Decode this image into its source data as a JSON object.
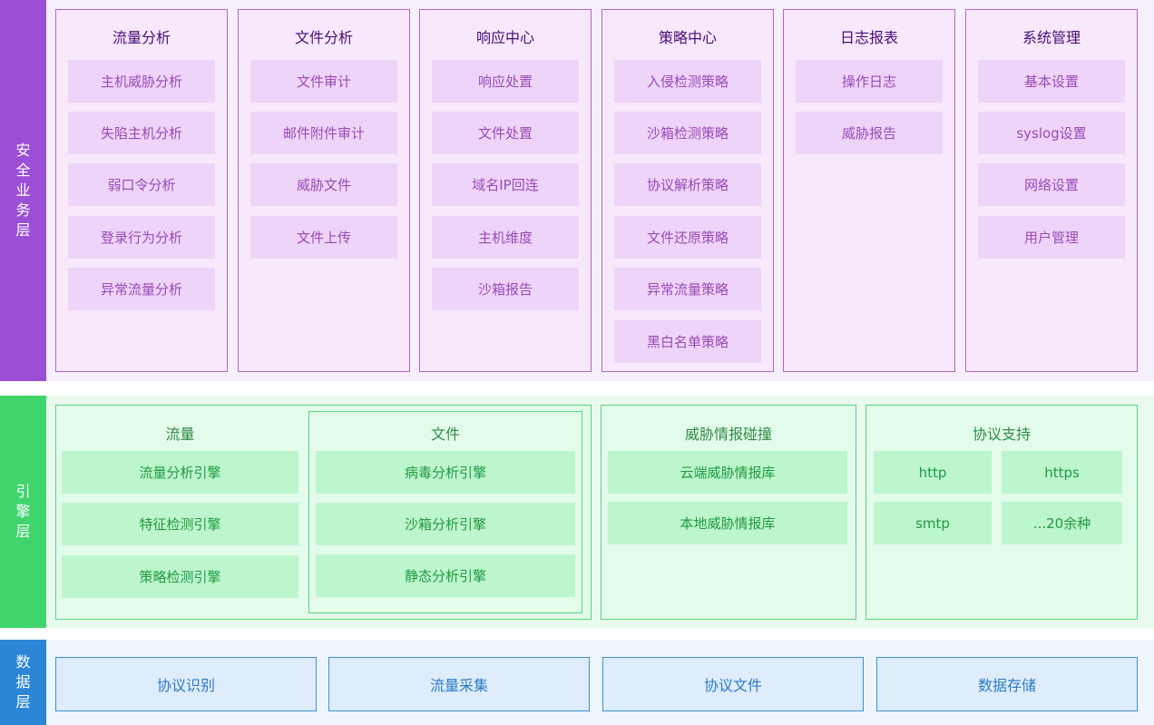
{
  "layers": {
    "security": {
      "label": "安全业务层",
      "columns": [
        {
          "title": "流量分析",
          "items": [
            "主机威胁分析",
            "失陷主机分析",
            "弱口令分析",
            "登录行为分析",
            "异常流量分析"
          ]
        },
        {
          "title": "文件分析",
          "items": [
            "文件审计",
            "邮件附件审计",
            "威胁文件",
            "文件上传"
          ]
        },
        {
          "title": "响应中心",
          "items": [
            "响应处置",
            "文件处置",
            "域名IP回连",
            "主机维度",
            "沙箱报告"
          ]
        },
        {
          "title": "策略中心",
          "items": [
            "入侵检测策略",
            "沙箱检测策略",
            "协议解析策略",
            "文件还原策略",
            "异常流量策略",
            "黑白名单策略"
          ]
        },
        {
          "title": "日志报表",
          "items": [
            "操作日志",
            "威胁报告"
          ]
        },
        {
          "title": "系统管理",
          "items": [
            "基本设置",
            "syslog设置",
            "网络设置",
            "用户管理"
          ]
        }
      ]
    },
    "engine": {
      "label": "引擎层",
      "traffic": {
        "title": "流量",
        "items": [
          "流量分析引擎",
          "特征检测引擎",
          "策略检测引擎"
        ]
      },
      "file": {
        "title": "文件",
        "items": [
          "病毒分析引擎",
          "沙箱分析引擎",
          "静态分析引擎"
        ]
      },
      "intel": {
        "title": "威胁情报碰撞",
        "items": [
          "云端威胁情报库",
          "本地威胁情报库"
        ]
      },
      "protocol": {
        "title": "协议支持",
        "items": [
          "http",
          "https",
          "smtp",
          "...20余种"
        ]
      }
    },
    "data": {
      "label": "数据层",
      "items": [
        "协议识别",
        "流量采集",
        "协议文件",
        "数据存储"
      ]
    }
  },
  "colors": {
    "security_accent": "#9b4fd6",
    "engine_accent": "#3fd56c",
    "data_accent": "#2b86d8"
  }
}
